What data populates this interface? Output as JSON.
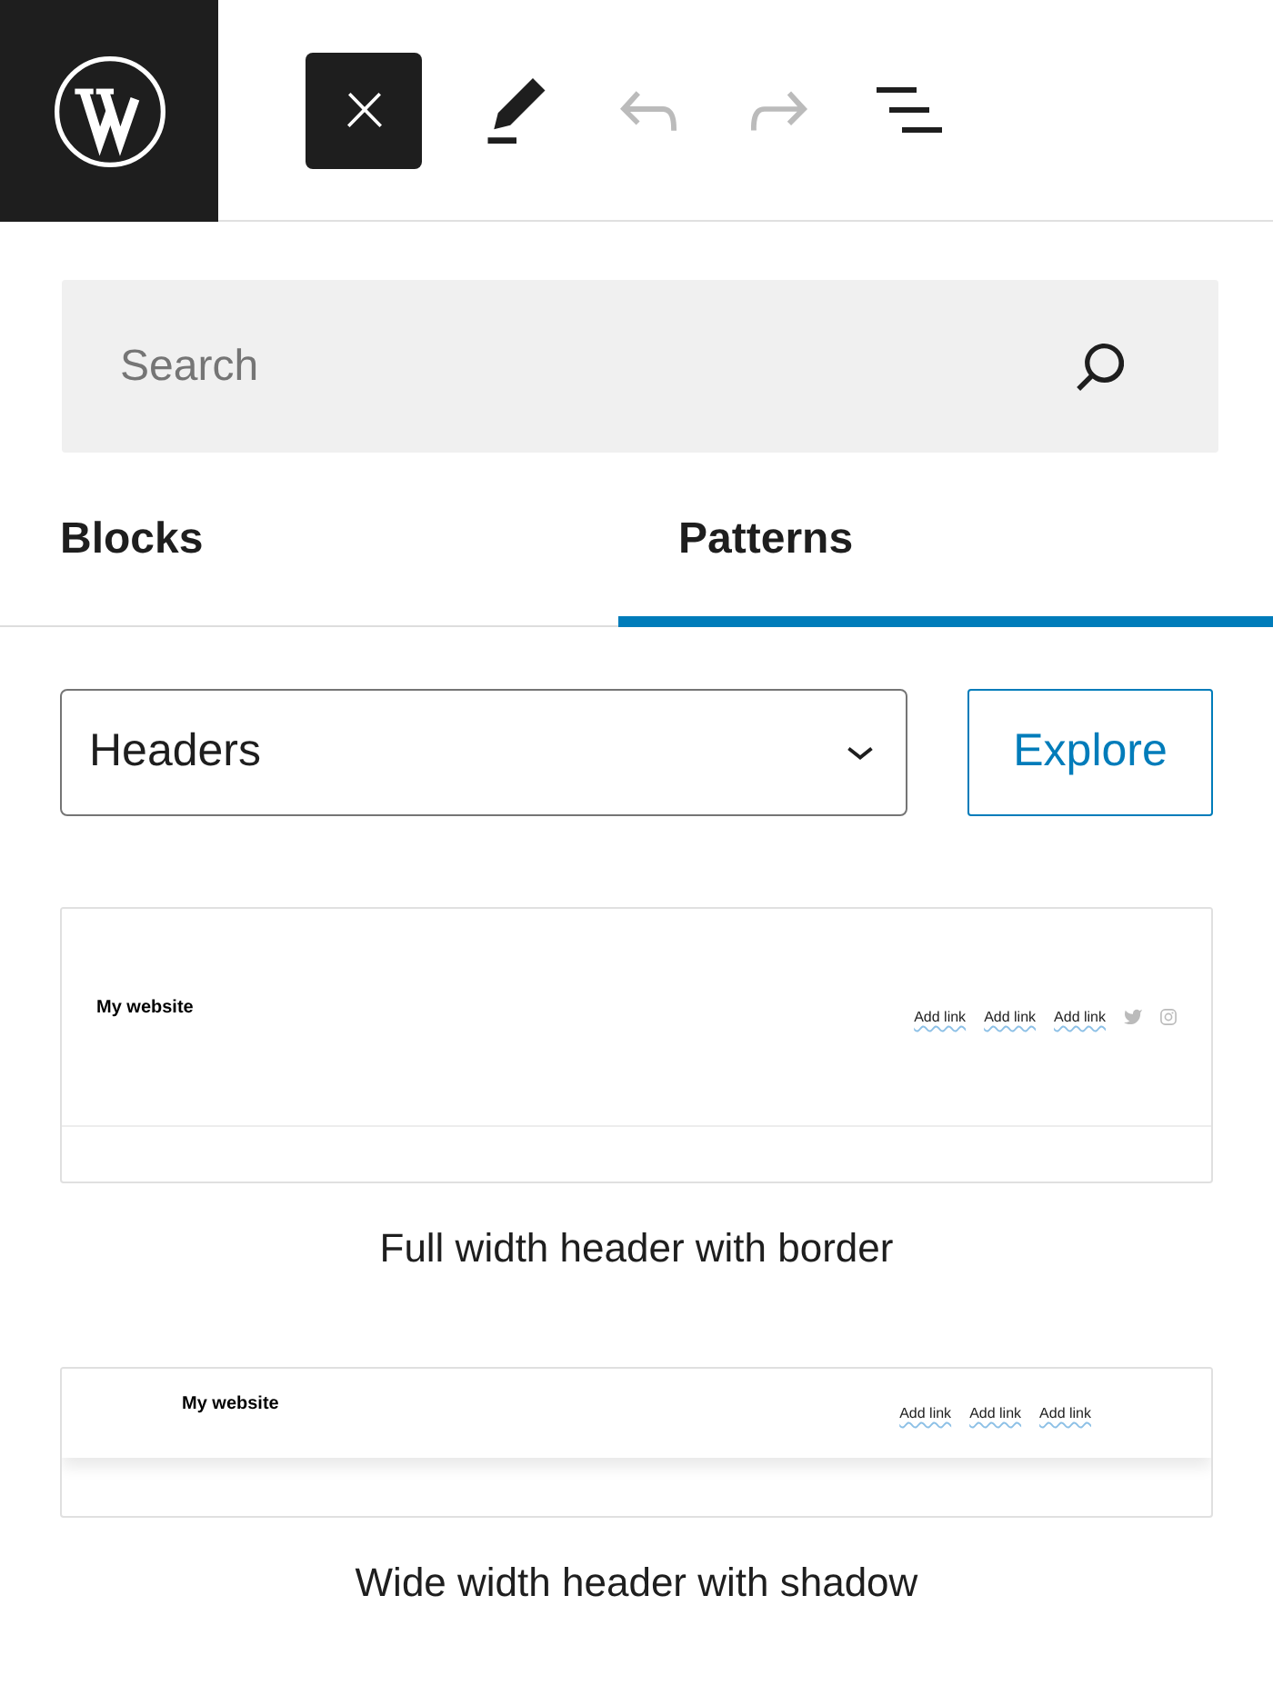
{
  "toolbar": [
    {
      "kind": "close",
      "disabled": false
    },
    {
      "kind": "edit",
      "disabled": false
    },
    {
      "kind": "undo",
      "disabled": true
    },
    {
      "kind": "redo",
      "disabled": true
    },
    {
      "kind": "list_view",
      "disabled": false
    }
  ],
  "search": {
    "placeholder": "Search"
  },
  "tabs": [
    {
      "label": "Blocks",
      "selected": false
    },
    {
      "label": "Patterns",
      "selected": true
    }
  ],
  "category_select": {
    "value": "Headers"
  },
  "explore_button": {
    "label": "Explore"
  },
  "patterns": [
    {
      "kind": "border",
      "preview": {
        "site_title": "My website",
        "links": [
          "Add link",
          "Add link",
          "Add link"
        ],
        "social_icons": true
      },
      "title": "Full width header with border"
    },
    {
      "kind": "shadow",
      "preview": {
        "site_title": "My website",
        "links": [
          "Add link",
          "Add link",
          "Add link"
        ],
        "social_icons": false
      },
      "title": "Wide width header with shadow"
    }
  ]
}
